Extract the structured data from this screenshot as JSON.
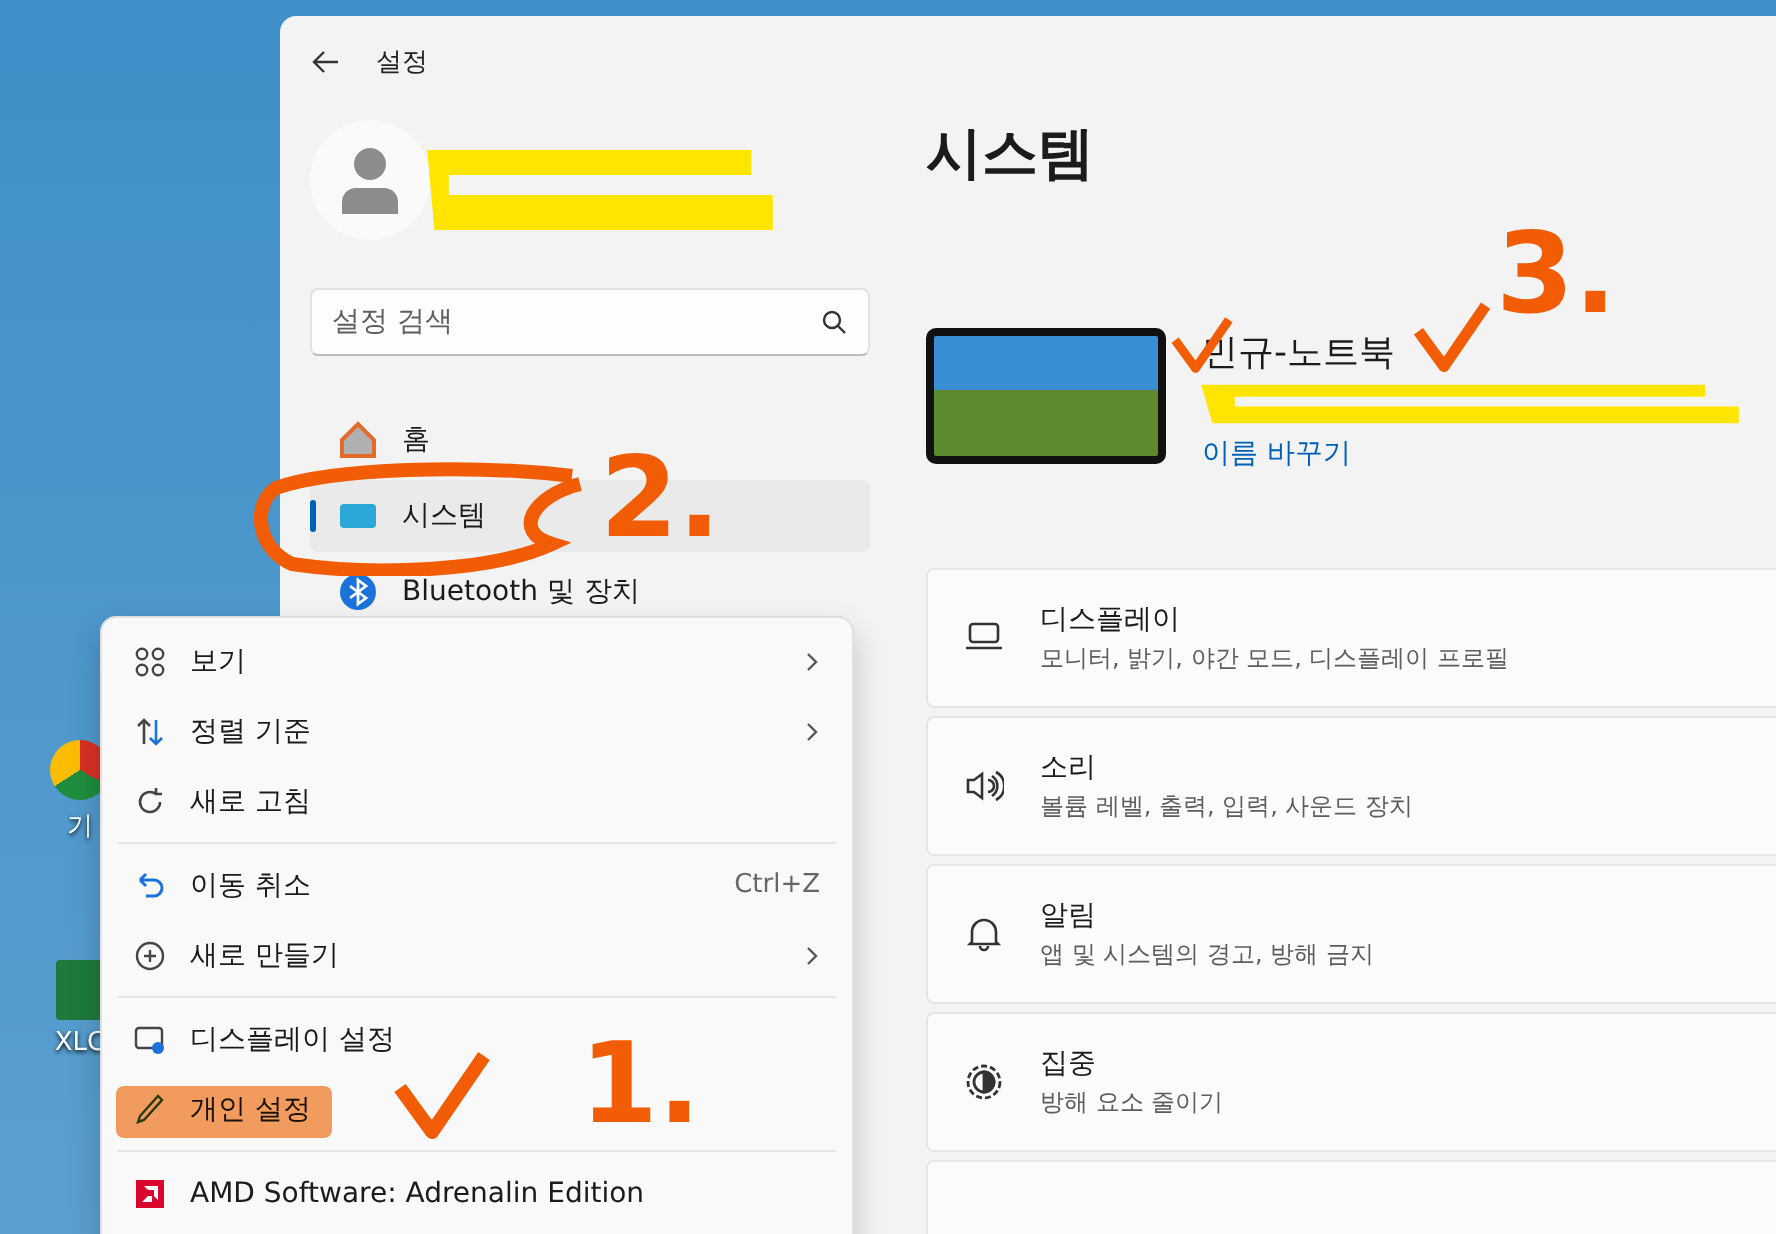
{
  "desktop": {
    "icons": [
      {
        "label": "기"
      },
      {
        "label": "XLC"
      }
    ]
  },
  "window": {
    "title": "설정"
  },
  "sidebar": {
    "search": {
      "placeholder": "설정 검색"
    },
    "items": [
      {
        "label": "홈",
        "selected": false
      },
      {
        "label": "시스템",
        "selected": true
      },
      {
        "label": "Bluetooth 및 장치",
        "selected": false
      }
    ]
  },
  "page": {
    "title": "시스템",
    "device": {
      "name": "민규-노트북",
      "rename_link": "이름 바꾸기"
    },
    "cards": [
      {
        "title": "디스플레이",
        "subtitle": "모니터, 밝기, 야간 모드, 디스플레이 프로필"
      },
      {
        "title": "소리",
        "subtitle": "볼륨 레벨, 출력, 입력, 사운드 장치"
      },
      {
        "title": "알림",
        "subtitle": "앱 및 시스템의 경고, 방해 금지"
      },
      {
        "title": "집중",
        "subtitle": "방해 요소 줄이기"
      }
    ]
  },
  "context_menu": {
    "items": [
      {
        "kind": "item",
        "label": "보기",
        "submenu": true
      },
      {
        "kind": "item",
        "label": "정렬 기준",
        "submenu": true
      },
      {
        "kind": "item",
        "label": "새로 고침",
        "submenu": false
      },
      {
        "kind": "separator"
      },
      {
        "kind": "item",
        "label": "이동 취소",
        "shortcut": "Ctrl+Z",
        "submenu": false
      },
      {
        "kind": "item",
        "label": "새로 만들기",
        "submenu": true
      },
      {
        "kind": "separator"
      },
      {
        "kind": "item",
        "label": "디스플레이 설정",
        "submenu": false
      },
      {
        "kind": "item",
        "label": "개인 설정",
        "submenu": false
      },
      {
        "kind": "separator"
      },
      {
        "kind": "item",
        "label": "AMD Software: Adrenalin Edition",
        "submenu": false
      }
    ]
  },
  "annotations": [
    {
      "kind": "redaction"
    },
    {
      "kind": "redaction"
    },
    {
      "kind": "circle"
    },
    {
      "kind": "number",
      "label": "2."
    },
    {
      "kind": "highlight"
    },
    {
      "kind": "check"
    },
    {
      "kind": "number",
      "label": "1."
    },
    {
      "kind": "check"
    },
    {
      "kind": "check"
    },
    {
      "kind": "number",
      "label": "3."
    }
  ]
}
